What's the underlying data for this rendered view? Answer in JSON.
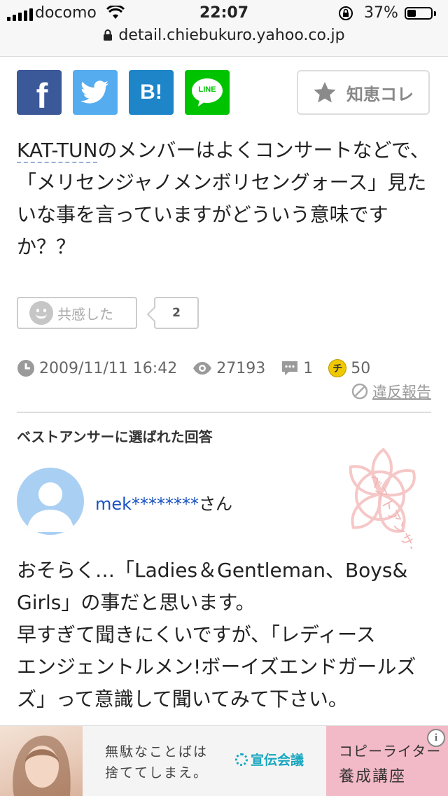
{
  "status_bar": {
    "carrier": "docomo",
    "time": "22:07",
    "battery_percent": "37%",
    "battery_level": 0.37
  },
  "browser": {
    "url": "detail.chiebukuro.yahoo.co.jp"
  },
  "share": {
    "icons": [
      "facebook-icon",
      "twitter-icon",
      "hatena-bookmark-icon",
      "line-icon"
    ],
    "hatena_label": "B!",
    "line_label": "LINE",
    "facebook_label": "f"
  },
  "chie_kore": {
    "label": "知恵コレ"
  },
  "question": {
    "keyword": "KAT-TUN",
    "text": "のメンバーはよくコンサートなどで、「メリセンジャノメンボリセングォース」見たいな事を言っていますがどういう意味ですか？？"
  },
  "empathy": {
    "label": "共感した",
    "count": "2"
  },
  "meta": {
    "datetime": "2009/11/11 16:42",
    "views": "27193",
    "answers": "1",
    "coin_label": "チ",
    "coins": "50"
  },
  "report": {
    "label": "違反報告"
  },
  "best_answer": {
    "heading": "ベストアンサーに選ばれた回答",
    "username": "mek********",
    "honorific": "さん",
    "stamp_text": "ベストアンサー",
    "lines": [
      "おそらく…「Ladies＆Gentleman、Boys&",
      "Girls」の事だと思います。",
      "早すぎて聞きにくいですが、「レディース",
      "エンジェントルメン!ボーイズエンドガールズ",
      "ズ」って意識して聞いてみて下さい。"
    ]
  },
  "ad": {
    "copy_line1": "無駄なことばは",
    "copy_line2": "捨ててしまえ。",
    "brand": "宣伝会議",
    "cta_line1": "コピーライター",
    "cta_line2": "養成講座",
    "info_label": "i"
  },
  "colors": {
    "facebook": "#3b5998",
    "twitter": "#55acee",
    "hatena": "#1d85c8",
    "line": "#00c300",
    "link_blue": "#1b53c4",
    "coin": "#f0c800"
  }
}
